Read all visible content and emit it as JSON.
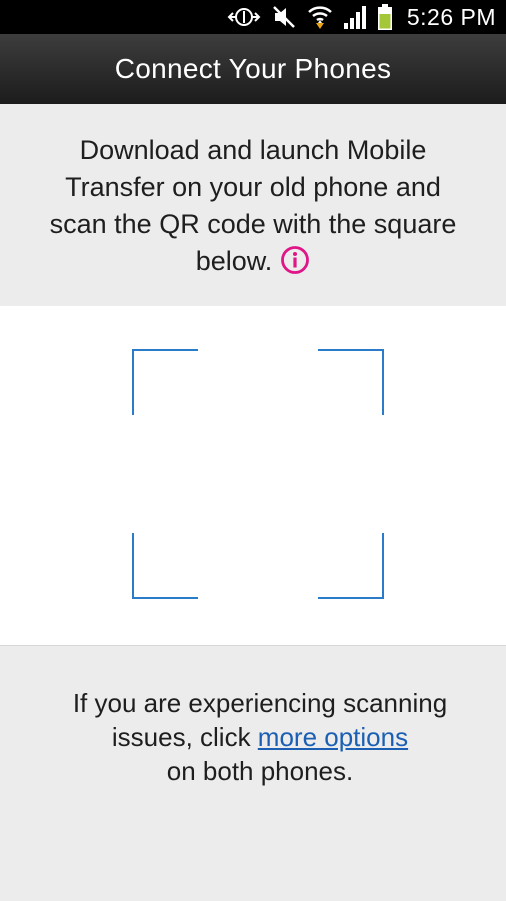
{
  "status_bar": {
    "time": "5:26 PM",
    "icons": [
      "data-sync-icon",
      "mute-icon",
      "wifi-icon",
      "signal-icon",
      "battery-icon"
    ],
    "battery_color": "#a4c639"
  },
  "header": {
    "title": "Connect Your Phones"
  },
  "instructions": {
    "text": "Download and launch Mobile Transfer on your old phone and scan the QR code with the square below.",
    "info_icon": "info-icon",
    "info_color": "#e01587"
  },
  "scanner": {
    "frame_color": "#2b7cc8"
  },
  "help": {
    "text_before": "If you are experiencing scanning issues, click ",
    "link_label": "more options",
    "text_after": " on both phones."
  }
}
